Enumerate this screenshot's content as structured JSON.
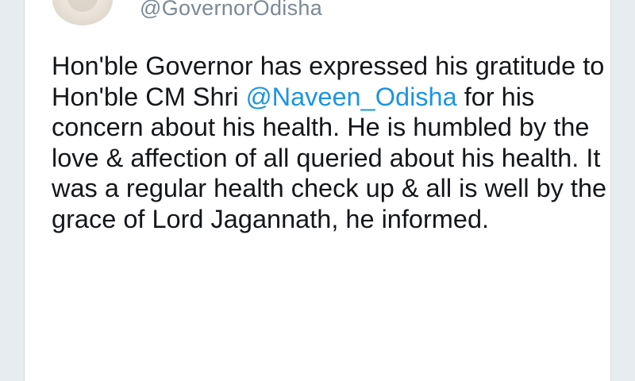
{
  "tweet": {
    "handle": "@GovernorOdisha",
    "text_before_mention": "Hon'ble Governor has expressed his gratitude to Hon'ble CM Shri ",
    "mention": "@Naveen_Odisha",
    "text_after_mention": " for his concern about his health. He is humbled by the love & affection of all queried about his health. It was a regular health check up & all is well by the grace of Lord Jagannath, he informed."
  },
  "colors": {
    "background": "#e6ecf0",
    "text": "#14171a",
    "handle": "#7b8a96",
    "link": "#1b95e0"
  }
}
